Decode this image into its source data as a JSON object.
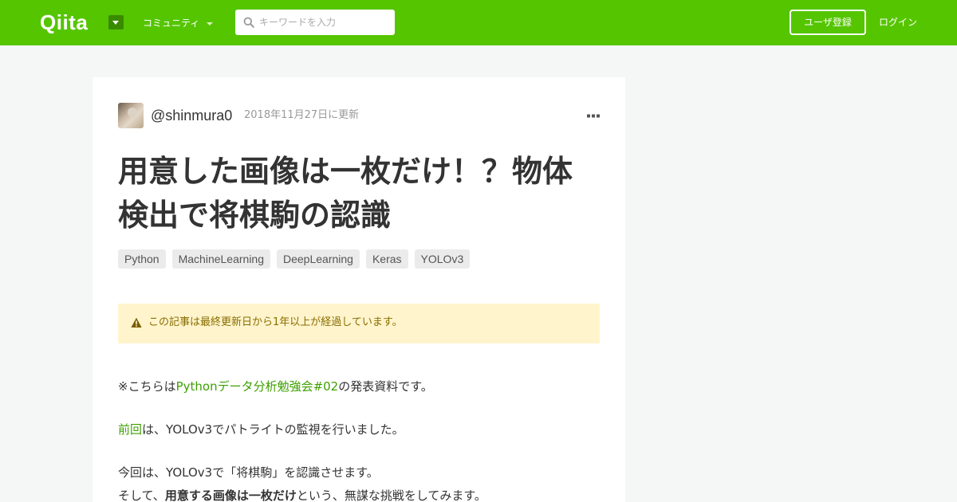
{
  "header": {
    "logo": "Qiita",
    "community_label": "コミュニティ",
    "search_placeholder": "キーワードを入力",
    "signup_label": "ユーザ登録",
    "login_label": "ログイン"
  },
  "article": {
    "username": "@shinmura0",
    "updated": "2018年11月27日に更新",
    "title": "用意した画像は一枚だけ！？物体検出で将棋駒の認識",
    "tags": [
      "Python",
      "MachineLearning",
      "DeepLearning",
      "Keras",
      "YOLOv3"
    ],
    "notice": "この記事は最終更新日から1年以上が経過しています。",
    "p1": {
      "prefix": "※こちらは",
      "link": "Pythonデータ分析勉強会#02",
      "suffix": "の発表資料です。"
    },
    "p2": {
      "link": "前回",
      "suffix": "は、YOLOv3でパトライトの監視を行いました。"
    },
    "p3": "今回は、YOLOv3で「将棋駒」を認識させます。",
    "p4": {
      "prefix": "そして、",
      "strong": "用意する画像は一枚だけ",
      "suffix": "という、無謀な挑戦をしてみます。"
    }
  },
  "colors": {
    "brand": "#55c500",
    "link": "#3ea000",
    "notice_bg": "#fff4cc"
  }
}
